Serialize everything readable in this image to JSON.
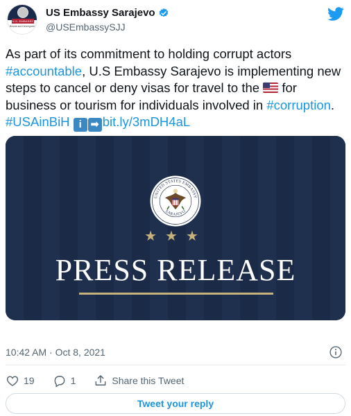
{
  "account": {
    "display_name": "US Embassy Sarajevo",
    "handle": "@USEmbassySJJ",
    "avatar_banner_text": "U.S. EMBASSY",
    "avatar_sub_text": "Bosnia and Herzegovina"
  },
  "tweet": {
    "text_parts": {
      "p1": "As part of its commitment to holding corrupt actors ",
      "hashtag_accountable": "#accountable",
      "p2": ", U.S Embassy Sarajevo is implementing new steps to cancel or deny visas for travel to the ",
      "p3": " for business or tourism for individuals involved in ",
      "hashtag_corruption": "#corruption",
      "p4": ". ",
      "hashtag_usainbih": "#USAinBiH",
      "emoji_info": "i",
      "emoji_arrow": "➡",
      "short_link": "bit.ly/3mDH4aL"
    },
    "timestamp": "10:42 AM · Oct 8, 2021"
  },
  "media": {
    "seal_top_text": "UNITED STATES EMBASSY",
    "seal_bottom_text": "SARAJEVO",
    "stars": "★★★",
    "headline": "PRESS RELEASE",
    "colors": {
      "background": "#1c2c4a",
      "gold": "#c8b27c"
    }
  },
  "actions": {
    "likes": "19",
    "replies": "1",
    "share_label": "Share this Tweet"
  },
  "reply_button": {
    "label": "Tweet your reply"
  },
  "icons": [
    "twitter-bird-icon",
    "verified-badge-icon",
    "info-icon",
    "heart-icon",
    "reply-icon",
    "share-icon",
    "us-flag-emoji-icon"
  ],
  "colors": {
    "link": "#1b95e0",
    "secondary_text": "#536471",
    "twitter_blue": "#1d9bf0"
  }
}
